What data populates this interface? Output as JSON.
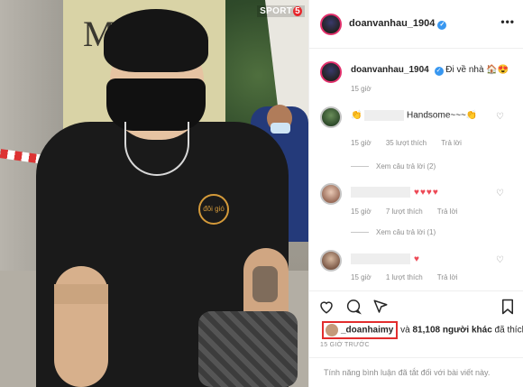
{
  "photo": {
    "sign_text": "MENO",
    "watermark": "SPORT",
    "watermark_badge": "5",
    "shirt_logo_text": "đôi gió"
  },
  "post": {
    "author": "doanvanhau_1904",
    "more_label": "•••",
    "verified_label": "✓"
  },
  "caption": {
    "username": "doanvanhau_1904",
    "text": "Đi về nhà 🏠😍",
    "time": "15 giờ"
  },
  "comments": [
    {
      "text": "Handsome~~~👏",
      "prefix": "👏",
      "time": "15 giờ",
      "likes": "35 lượt thích",
      "reply": "Trả lời",
      "view_replies": "Xem câu trả lời (2)"
    },
    {
      "hearts": "♥♥♥♥",
      "time": "15 giờ",
      "likes": "7 lượt thích",
      "reply": "Trả lời",
      "view_replies": "Xem câu trả lời (1)"
    },
    {
      "hearts": "♥",
      "time": "15 giờ",
      "likes": "1 lượt thích",
      "reply": "Trả lời"
    }
  ],
  "likes_row": {
    "user": "_doanhaimy",
    "and_text": "và",
    "count_text": "81,108 người khác",
    "suffix": "đã thích"
  },
  "time_ago": "15 GIỜ TRƯỚC",
  "comments_disabled": "Tính năng bình luận đã tắt đối với bài viết này."
}
